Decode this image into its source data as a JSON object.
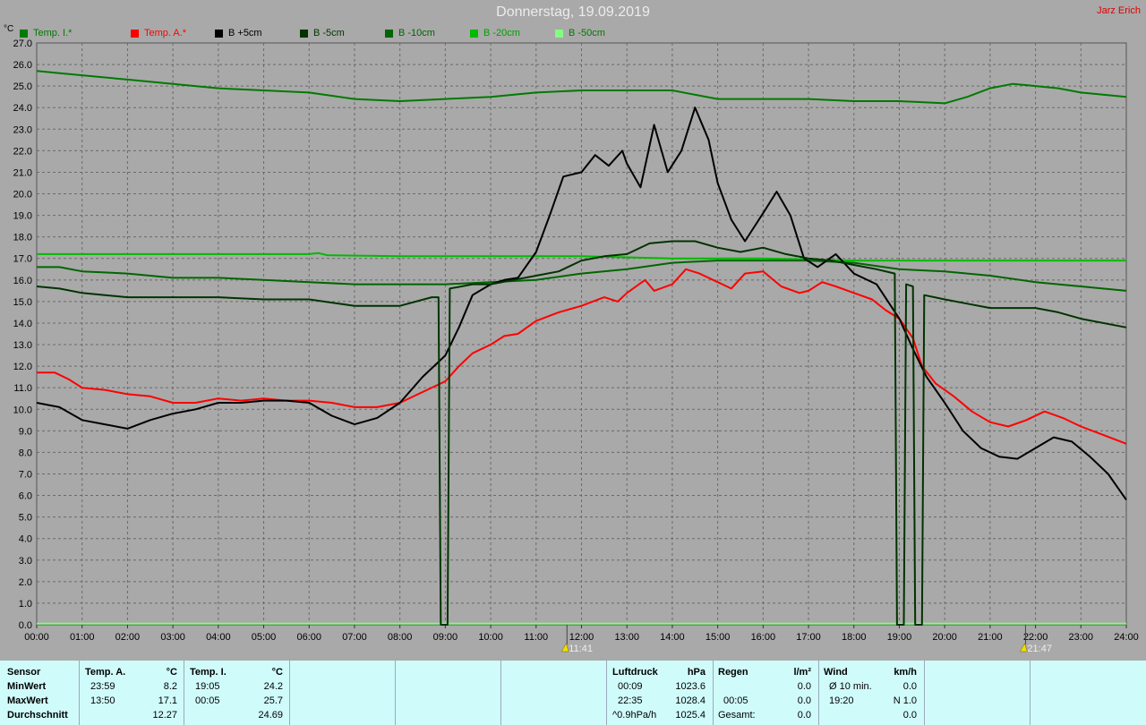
{
  "header": {
    "title": "Donnerstag, 19.09.2019",
    "author": "Jarz Erich",
    "unit": "°C"
  },
  "legend": [
    {
      "label": "Temp. I.*",
      "color": "#007a00"
    },
    {
      "label": "Temp. A.*",
      "color": "#ff0000"
    },
    {
      "label": "B +5cm",
      "color": "#000000"
    },
    {
      "label": "B -5cm",
      "color": "#003300"
    },
    {
      "label": "B -10cm",
      "color": "#006600"
    },
    {
      "label": "B -20cm",
      "color": "#00bb00"
    },
    {
      "label": "B -50cm",
      "color": "#80ff80"
    }
  ],
  "chart_data": {
    "type": "line",
    "title": "Donnerstag, 19.09.2019",
    "ylabel": "°C",
    "ylim": [
      0,
      27
    ],
    "yticks": [
      "0.0",
      "1.0",
      "2.0",
      "3.0",
      "4.0",
      "5.0",
      "6.0",
      "7.0",
      "8.0",
      "9.0",
      "10.0",
      "11.0",
      "12.0",
      "13.0",
      "14.0",
      "15.0",
      "16.0",
      "17.0",
      "18.0",
      "19.0",
      "20.0",
      "21.0",
      "22.0",
      "23.0",
      "24.0",
      "25.0",
      "26.0",
      "27.0"
    ],
    "xlim": [
      0,
      24
    ],
    "xticks": [
      "00:00",
      "01:00",
      "02:00",
      "03:00",
      "04:00",
      "05:00",
      "06:00",
      "07:00",
      "08:00",
      "09:00",
      "10:00",
      "11:00",
      "12:00",
      "13:00",
      "14:00",
      "15:00",
      "16:00",
      "17:00",
      "18:00",
      "19:00",
      "20:00",
      "21:00",
      "22:00",
      "23:00",
      "24:00"
    ],
    "grid": true,
    "legend_position": "top-left",
    "markers": [
      {
        "x": 11.68,
        "label": "11:41"
      },
      {
        "x": 21.78,
        "label": "21:47"
      }
    ],
    "series": [
      {
        "name": "Temp. I.*",
        "color": "#007a00",
        "points": [
          [
            0,
            25.7
          ],
          [
            0.5,
            25.6
          ],
          [
            1,
            25.5
          ],
          [
            2,
            25.3
          ],
          [
            3,
            25.1
          ],
          [
            4,
            24.9
          ],
          [
            5,
            24.8
          ],
          [
            6,
            24.7
          ],
          [
            7,
            24.4
          ],
          [
            8,
            24.3
          ],
          [
            9,
            24.4
          ],
          [
            10,
            24.5
          ],
          [
            11,
            24.7
          ],
          [
            12,
            24.8
          ],
          [
            13,
            24.8
          ],
          [
            14,
            24.8
          ],
          [
            15,
            24.4
          ],
          [
            16,
            24.4
          ],
          [
            17,
            24.4
          ],
          [
            18,
            24.3
          ],
          [
            19,
            24.3
          ],
          [
            20,
            24.2
          ],
          [
            20.5,
            24.5
          ],
          [
            21,
            24.9
          ],
          [
            21.5,
            25.1
          ],
          [
            22,
            25.0
          ],
          [
            22.5,
            24.9
          ],
          [
            23,
            24.7
          ],
          [
            24,
            24.5
          ]
        ]
      },
      {
        "name": "Temp. A.*",
        "color": "#ff0000",
        "points": [
          [
            0,
            11.7
          ],
          [
            0.4,
            11.7
          ],
          [
            0.7,
            11.4
          ],
          [
            1,
            11.0
          ],
          [
            1.5,
            10.9
          ],
          [
            2,
            10.7
          ],
          [
            2.5,
            10.6
          ],
          [
            3,
            10.3
          ],
          [
            3.5,
            10.3
          ],
          [
            4,
            10.5
          ],
          [
            4.5,
            10.4
          ],
          [
            5,
            10.5
          ],
          [
            5.5,
            10.4
          ],
          [
            6,
            10.4
          ],
          [
            6.5,
            10.3
          ],
          [
            7,
            10.1
          ],
          [
            7.5,
            10.1
          ],
          [
            8,
            10.3
          ],
          [
            8.5,
            10.8
          ],
          [
            9,
            11.3
          ],
          [
            9.3,
            12.0
          ],
          [
            9.6,
            12.6
          ],
          [
            10,
            13.0
          ],
          [
            10.3,
            13.4
          ],
          [
            10.6,
            13.5
          ],
          [
            11,
            14.1
          ],
          [
            11.5,
            14.5
          ],
          [
            12,
            14.8
          ],
          [
            12.5,
            15.2
          ],
          [
            12.8,
            15.0
          ],
          [
            13,
            15.4
          ],
          [
            13.4,
            16.0
          ],
          [
            13.6,
            15.5
          ],
          [
            14,
            15.8
          ],
          [
            14.3,
            16.5
          ],
          [
            14.6,
            16.3
          ],
          [
            15,
            15.9
          ],
          [
            15.3,
            15.6
          ],
          [
            15.6,
            16.3
          ],
          [
            16,
            16.4
          ],
          [
            16.4,
            15.7
          ],
          [
            16.8,
            15.4
          ],
          [
            17,
            15.5
          ],
          [
            17.3,
            15.9
          ],
          [
            17.6,
            15.7
          ],
          [
            18,
            15.4
          ],
          [
            18.4,
            15.1
          ],
          [
            18.7,
            14.6
          ],
          [
            19,
            14.2
          ],
          [
            19.3,
            13.3
          ],
          [
            19.5,
            12.0
          ],
          [
            19.8,
            11.2
          ],
          [
            20.2,
            10.6
          ],
          [
            20.6,
            9.9
          ],
          [
            21,
            9.4
          ],
          [
            21.4,
            9.2
          ],
          [
            21.8,
            9.5
          ],
          [
            22.2,
            9.9
          ],
          [
            22.6,
            9.6
          ],
          [
            23,
            9.2
          ],
          [
            23.5,
            8.8
          ],
          [
            24,
            8.4
          ]
        ]
      },
      {
        "name": "B +5cm",
        "color": "#000000",
        "points": [
          [
            0,
            10.3
          ],
          [
            0.5,
            10.1
          ],
          [
            1,
            9.5
          ],
          [
            1.5,
            9.3
          ],
          [
            2,
            9.1
          ],
          [
            2.5,
            9.5
          ],
          [
            3,
            9.8
          ],
          [
            3.5,
            10.0
          ],
          [
            4,
            10.3
          ],
          [
            4.5,
            10.3
          ],
          [
            5,
            10.4
          ],
          [
            5.5,
            10.4
          ],
          [
            6,
            10.3
          ],
          [
            6.5,
            9.7
          ],
          [
            7,
            9.3
          ],
          [
            7.5,
            9.6
          ],
          [
            8,
            10.3
          ],
          [
            8.5,
            11.5
          ],
          [
            9,
            12.5
          ],
          [
            9.3,
            13.8
          ],
          [
            9.6,
            15.3
          ],
          [
            10,
            15.8
          ],
          [
            10.3,
            16.0
          ],
          [
            10.6,
            16.1
          ],
          [
            11,
            17.3
          ],
          [
            11.3,
            19.0
          ],
          [
            11.6,
            20.8
          ],
          [
            12,
            21.0
          ],
          [
            12.3,
            21.8
          ],
          [
            12.6,
            21.3
          ],
          [
            12.9,
            22.0
          ],
          [
            13,
            21.4
          ],
          [
            13.3,
            20.3
          ],
          [
            13.6,
            23.2
          ],
          [
            13.9,
            21.0
          ],
          [
            14.2,
            22.0
          ],
          [
            14.5,
            24.0
          ],
          [
            14.8,
            22.5
          ],
          [
            15,
            20.5
          ],
          [
            15.3,
            18.8
          ],
          [
            15.6,
            17.8
          ],
          [
            16,
            19.1
          ],
          [
            16.3,
            20.1
          ],
          [
            16.6,
            19.0
          ],
          [
            16.9,
            17.0
          ],
          [
            17.2,
            16.6
          ],
          [
            17.6,
            17.2
          ],
          [
            18,
            16.3
          ],
          [
            18.5,
            15.8
          ],
          [
            19,
            14.2
          ],
          [
            19.3,
            12.8
          ],
          [
            19.6,
            11.5
          ],
          [
            20,
            10.3
          ],
          [
            20.4,
            9.0
          ],
          [
            20.8,
            8.2
          ],
          [
            21.2,
            7.8
          ],
          [
            21.6,
            7.7
          ],
          [
            22,
            8.2
          ],
          [
            22.4,
            8.7
          ],
          [
            22.8,
            8.5
          ],
          [
            23.2,
            7.8
          ],
          [
            23.6,
            7.0
          ],
          [
            24,
            5.8
          ]
        ]
      },
      {
        "name": "B -5cm",
        "color": "#003300",
        "points": [
          [
            0,
            15.7
          ],
          [
            0.5,
            15.6
          ],
          [
            1,
            15.4
          ],
          [
            1.5,
            15.3
          ],
          [
            2,
            15.2
          ],
          [
            3,
            15.2
          ],
          [
            4,
            15.2
          ],
          [
            5,
            15.1
          ],
          [
            6,
            15.1
          ],
          [
            7,
            14.8
          ],
          [
            8,
            14.8
          ],
          [
            8.7,
            15.2
          ],
          [
            8.85,
            15.2
          ],
          [
            8.9,
            0.0
          ],
          [
            9.05,
            0.0
          ],
          [
            9.1,
            15.6
          ],
          [
            9.6,
            15.8
          ],
          [
            10,
            15.8
          ],
          [
            10.5,
            16.0
          ],
          [
            11,
            16.2
          ],
          [
            11.5,
            16.4
          ],
          [
            12,
            16.9
          ],
          [
            12.5,
            17.1
          ],
          [
            13,
            17.2
          ],
          [
            13.5,
            17.7
          ],
          [
            14,
            17.8
          ],
          [
            14.5,
            17.8
          ],
          [
            15,
            17.5
          ],
          [
            15.5,
            17.3
          ],
          [
            16,
            17.5
          ],
          [
            16.5,
            17.2
          ],
          [
            17,
            17.0
          ],
          [
            17.5,
            16.9
          ],
          [
            18,
            16.7
          ],
          [
            18.5,
            16.5
          ],
          [
            18.9,
            16.3
          ],
          [
            18.95,
            0.0
          ],
          [
            19.1,
            0.0
          ],
          [
            19.15,
            15.8
          ],
          [
            19.3,
            15.7
          ],
          [
            19.35,
            0.0
          ],
          [
            19.5,
            0.0
          ],
          [
            19.55,
            15.3
          ],
          [
            20,
            15.1
          ],
          [
            20.5,
            14.9
          ],
          [
            21,
            14.7
          ],
          [
            22,
            14.7
          ],
          [
            22.5,
            14.5
          ],
          [
            23,
            14.2
          ],
          [
            24,
            13.8
          ]
        ]
      },
      {
        "name": "B -10cm",
        "color": "#006600",
        "points": [
          [
            0,
            16.6
          ],
          [
            0.5,
            16.6
          ],
          [
            1,
            16.4
          ],
          [
            2,
            16.3
          ],
          [
            3,
            16.1
          ],
          [
            4,
            16.1
          ],
          [
            5,
            16.0
          ],
          [
            6,
            15.9
          ],
          [
            7,
            15.8
          ],
          [
            8,
            15.8
          ],
          [
            9,
            15.8
          ],
          [
            10,
            15.9
          ],
          [
            11,
            16.0
          ],
          [
            12,
            16.3
          ],
          [
            13,
            16.5
          ],
          [
            14,
            16.8
          ],
          [
            15,
            16.9
          ],
          [
            16,
            16.9
          ],
          [
            17,
            16.9
          ],
          [
            18,
            16.8
          ],
          [
            19,
            16.5
          ],
          [
            20,
            16.4
          ],
          [
            21,
            16.2
          ],
          [
            22,
            15.9
          ],
          [
            23,
            15.7
          ],
          [
            24,
            15.5
          ]
        ]
      },
      {
        "name": "B -20cm",
        "color": "#00bb00",
        "points": [
          [
            0,
            17.2
          ],
          [
            6,
            17.2
          ],
          [
            6.2,
            17.25
          ],
          [
            6.4,
            17.15
          ],
          [
            8,
            17.1
          ],
          [
            12,
            17.1
          ],
          [
            14,
            17.0
          ],
          [
            16,
            17.0
          ],
          [
            18,
            16.9
          ],
          [
            20,
            16.9
          ],
          [
            24,
            16.9
          ]
        ]
      },
      {
        "name": "B -50cm",
        "color": "#80ff80",
        "points": [
          [
            0,
            0.05
          ],
          [
            24,
            0.05
          ]
        ]
      }
    ]
  },
  "stats": {
    "sensor_header": "Sensor",
    "row_labels": [
      "MinWert",
      "MaxWert",
      "Durchschnitt"
    ],
    "temp_a": {
      "title": "Temp. A.",
      "unit": "°C",
      "min_time": "23:59",
      "min_val": "8.2",
      "max_time": "13:50",
      "max_val": "17.1",
      "avg": "12.27"
    },
    "temp_i": {
      "title": "Temp. I.",
      "unit": "°C",
      "min_time": "19:05",
      "min_val": "24.2",
      "max_time": "00:05",
      "max_val": "25.7",
      "avg": "24.69"
    },
    "pressure": {
      "title": "Luftdruck",
      "unit": "hPa",
      "min_time": "00:09",
      "min_val": "1023.6",
      "max_time": "22:35",
      "max_val": "1028.4",
      "trend": "^0.9hPa/h",
      "current": "1025.4"
    },
    "rain": {
      "title": "Regen",
      "unit": "l/m²",
      "min_val": "0.0",
      "max_time": "00:05",
      "max_val": "0.0",
      "total_label": "Gesamt:",
      "total": "0.0"
    },
    "wind": {
      "title": "Wind",
      "unit": "km/h",
      "avg_label": "Ø 10 min.",
      "avg_val": "0.0",
      "max_time": "19:20",
      "max_val": "N 1.0",
      "current": "0.0"
    }
  }
}
